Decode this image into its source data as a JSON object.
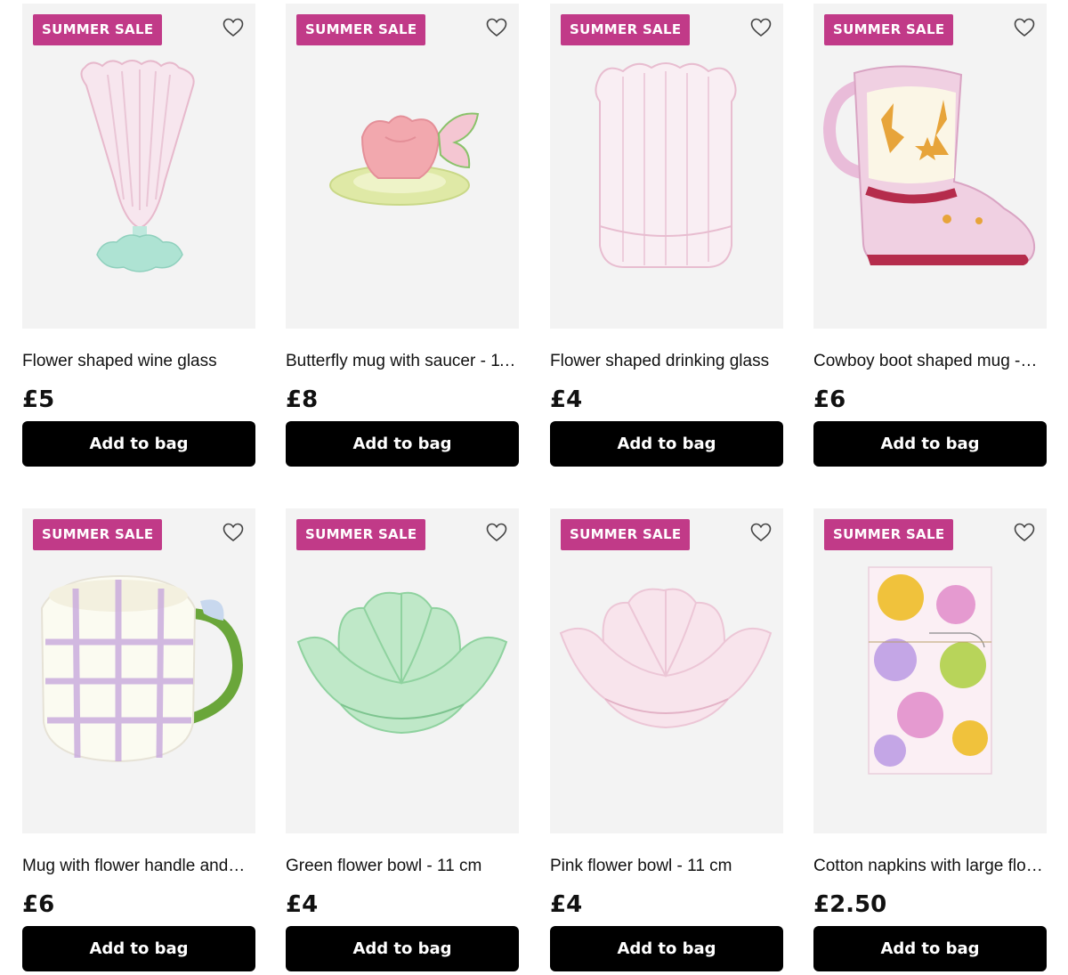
{
  "products": [
    {
      "badge": "SUMMER SALE",
      "title": "Flower shaped wine glass",
      "price": "£5",
      "cta": "Add to bag",
      "image": "flower-wine-glass"
    },
    {
      "badge": "SUMMER SALE",
      "title": "Butterfly mug with saucer - 11…",
      "price": "£8",
      "cta": "Add to bag",
      "image": "butterfly-mug"
    },
    {
      "badge": "SUMMER SALE",
      "title": "Flower shaped drinking glass",
      "price": "£4",
      "cta": "Add to bag",
      "image": "flower-drinking-glass"
    },
    {
      "badge": "SUMMER SALE",
      "title": "Cowboy boot shaped mug -…",
      "price": "£6",
      "cta": "Add to bag",
      "image": "cowboy-boot-mug"
    },
    {
      "badge": "SUMMER SALE",
      "title": "Mug with flower handle and…",
      "price": "£6",
      "cta": "Add to bag",
      "image": "flower-handle-mug"
    },
    {
      "badge": "SUMMER SALE",
      "title": "Green flower bowl - 11 cm",
      "price": "£4",
      "cta": "Add to bag",
      "image": "green-flower-bowl"
    },
    {
      "badge": "SUMMER SALE",
      "title": "Pink flower bowl - 11 cm",
      "price": "£4",
      "cta": "Add to bag",
      "image": "pink-flower-bowl"
    },
    {
      "badge": "SUMMER SALE",
      "title": "Cotton napkins with large flo…",
      "price": "£2.50",
      "cta": "Add to bag",
      "image": "floral-napkins"
    }
  ],
  "icons": {
    "favourite": "heart-outline-icon"
  },
  "colors": {
    "badge": "#c13a88",
    "button": "#000000",
    "image_bg": "#f3f3f3"
  }
}
